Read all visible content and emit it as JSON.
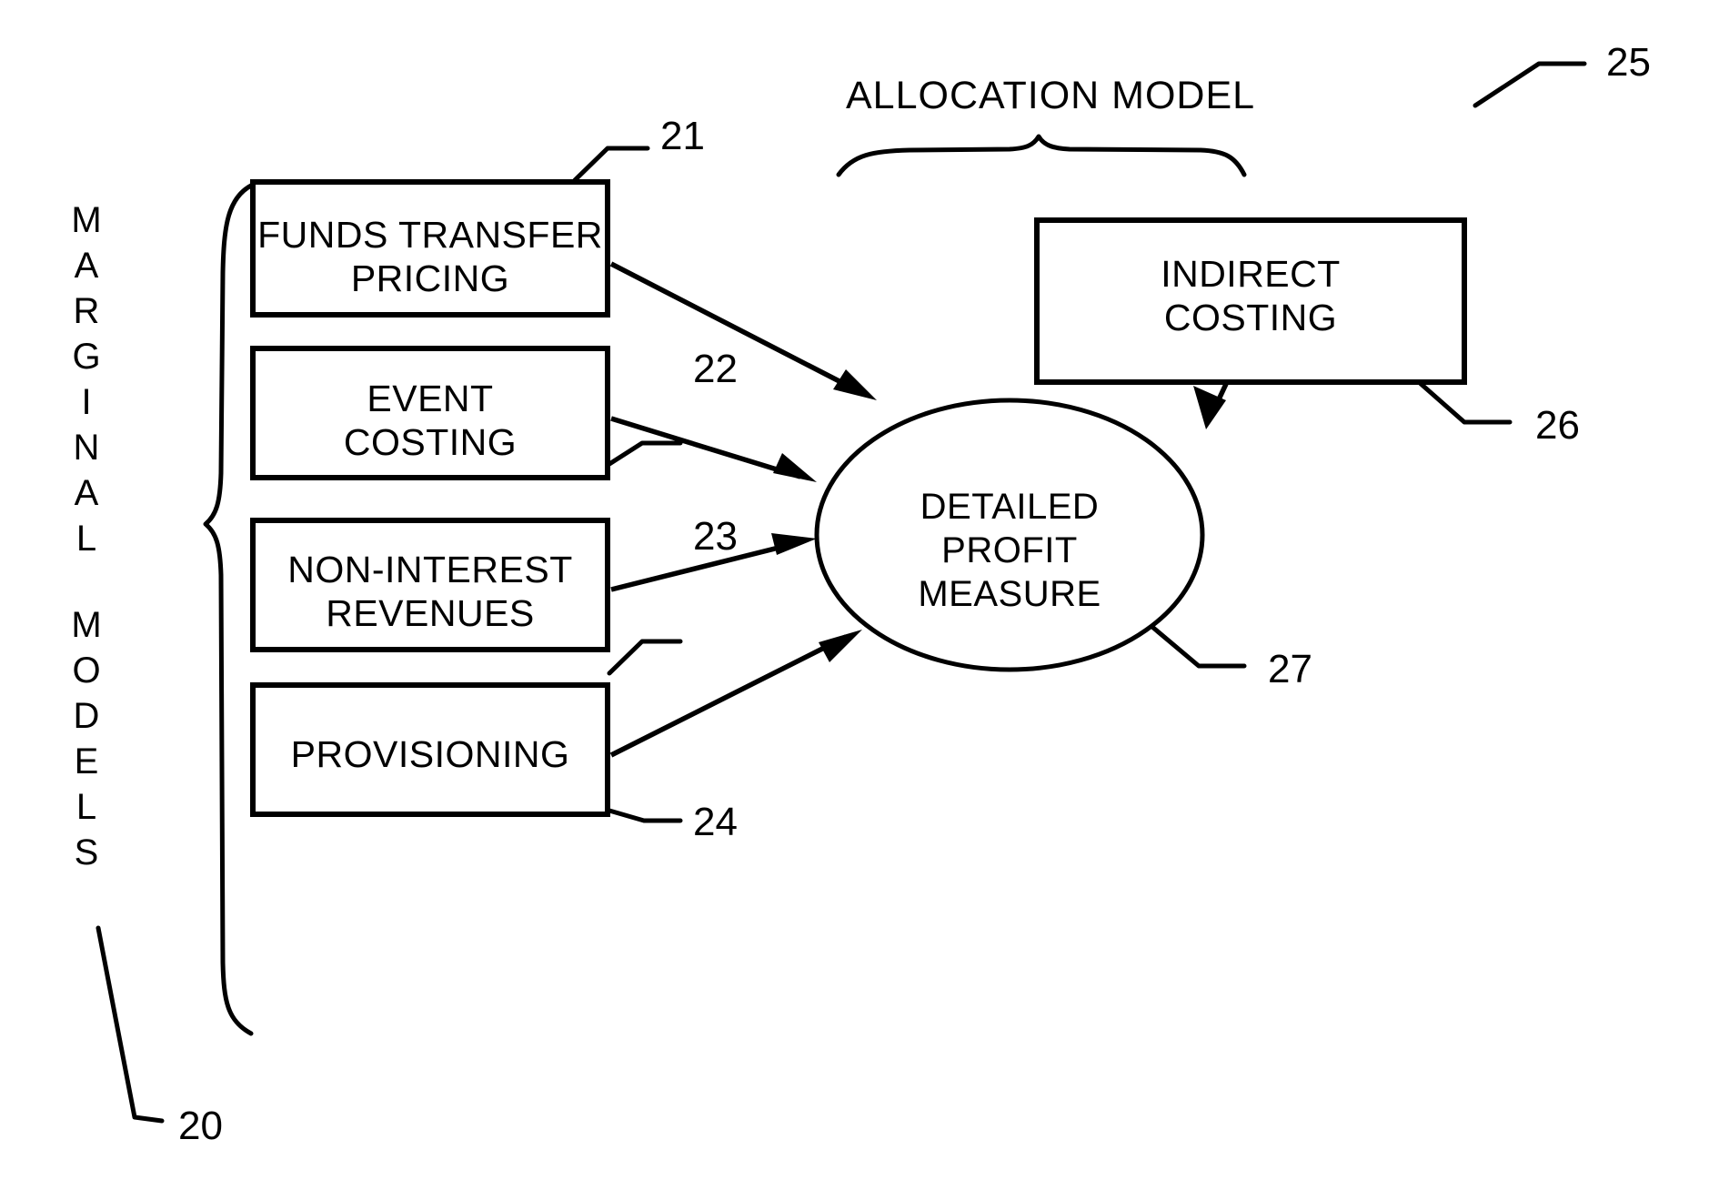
{
  "figure": {
    "title": "Allocation and marginal models profit measure diagram",
    "background_color": "#ffffff",
    "line_color": "#000000"
  },
  "left_group": {
    "label_text": "MARGINAL MODELS",
    "label_letters": [
      "M",
      "A",
      "R",
      "G",
      "I",
      "N",
      "A",
      "L",
      "",
      "M",
      "O",
      "D",
      "E",
      "L",
      "S"
    ],
    "brace_orientation": "vertical-left",
    "ref": "20"
  },
  "right_group": {
    "label_text": "ALLOCATION MODEL",
    "brace_orientation": "horizontal-top",
    "ref": "25"
  },
  "boxes": [
    {
      "id": "funds-transfer-pricing",
      "lines": [
        "FUNDS TRANSFER",
        "PRICING"
      ],
      "ref": "21"
    },
    {
      "id": "event-costing",
      "lines": [
        "EVENT",
        "COSTING"
      ],
      "ref": "22"
    },
    {
      "id": "non-interest-revenues",
      "lines": [
        "NON-INTEREST",
        "REVENUES"
      ],
      "ref": "23"
    },
    {
      "id": "provisioning",
      "lines": [
        "PROVISIONING"
      ],
      "ref": "24"
    },
    {
      "id": "indirect-costing",
      "lines": [
        "INDIRECT",
        "COSTING"
      ],
      "ref": "26"
    }
  ],
  "ellipse": {
    "id": "detailed-profit-measure",
    "lines": [
      "DETAILED",
      "PROFIT",
      "MEASURE"
    ],
    "ref": "27"
  },
  "connections": [
    {
      "from": "funds-transfer-pricing",
      "to": "detailed-profit-measure",
      "style": "arrow"
    },
    {
      "from": "event-costing",
      "to": "detailed-profit-measure",
      "style": "arrow"
    },
    {
      "from": "non-interest-revenues",
      "to": "detailed-profit-measure",
      "style": "arrow"
    },
    {
      "from": "provisioning",
      "to": "detailed-profit-measure",
      "style": "arrow"
    },
    {
      "from": "indirect-costing",
      "to": "detailed-profit-measure",
      "style": "arrow"
    }
  ],
  "reference_numerals": [
    "20",
    "21",
    "22",
    "23",
    "24",
    "25",
    "26",
    "27"
  ]
}
